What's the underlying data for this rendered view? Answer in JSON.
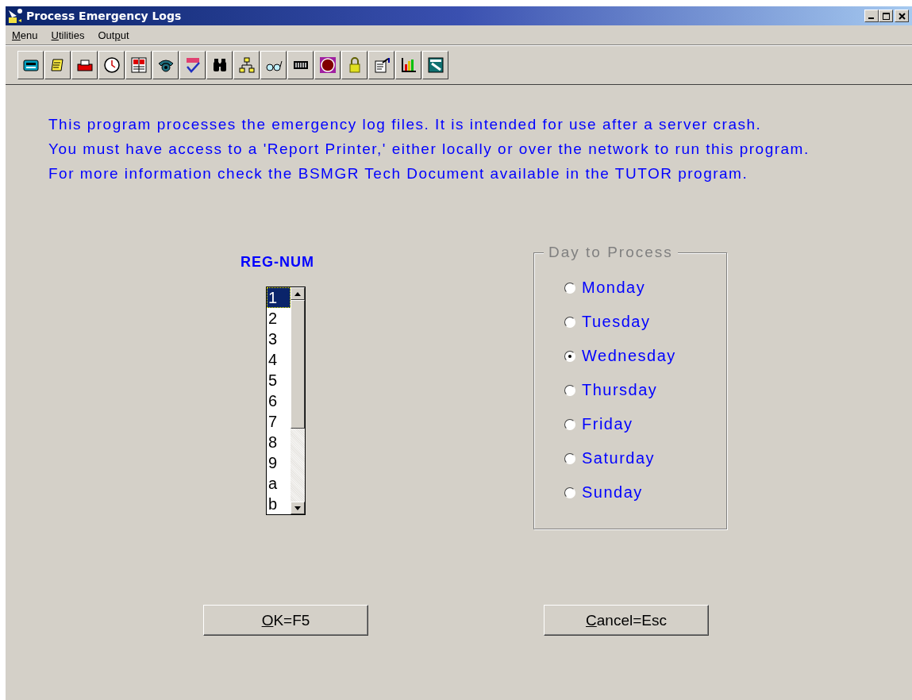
{
  "window": {
    "title": "Process Emergency Logs"
  },
  "menu": [
    {
      "key": "M",
      "post": "enu"
    },
    {
      "key": "U",
      "post": "tilities"
    },
    {
      "pre": "Out",
      "key": "p",
      "post": "ut"
    }
  ],
  "instructions": [
    "This program processes the emergency log files.  It is intended for use after a server crash.",
    "You must have access to a 'Report Printer,' either locally or over the network to run this program.",
    "For more information check the BSMGR Tech Document available in the TUTOR program."
  ],
  "reg_num": {
    "label": "REG-NUM",
    "items": [
      {
        "text": "1",
        "selected": true
      },
      {
        "text": "2",
        "selected": false
      },
      {
        "text": "3",
        "selected": false
      },
      {
        "text": "4",
        "selected": false
      },
      {
        "text": "5",
        "selected": false
      },
      {
        "text": "6",
        "selected": false
      },
      {
        "text": "7",
        "selected": false
      },
      {
        "text": "8",
        "selected": false
      },
      {
        "text": "9",
        "selected": false
      },
      {
        "text": "a",
        "selected": false
      },
      {
        "text": "b",
        "selected": false
      }
    ]
  },
  "day_group": {
    "title": "Day to Process",
    "options": [
      {
        "label": "Monday",
        "selected": false
      },
      {
        "label": "Tuesday",
        "selected": false
      },
      {
        "label": "Wednesday",
        "selected": true
      },
      {
        "label": "Thursday",
        "selected": false
      },
      {
        "label": "Friday",
        "selected": false
      },
      {
        "label": "Saturday",
        "selected": false
      },
      {
        "label": "Sunday",
        "selected": false
      }
    ]
  },
  "buttons": [
    {
      "key": "O",
      "post": "K=F5"
    },
    {
      "key": "C",
      "post": "ancel=Esc"
    }
  ]
}
